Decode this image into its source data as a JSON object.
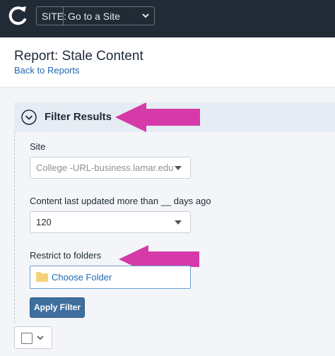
{
  "topbar": {
    "site_label": "SITE:",
    "site_value": "Go to a Site"
  },
  "header": {
    "title": "Report: Stale Content",
    "back_link": "Back to Reports"
  },
  "filter": {
    "title": "Filter Results",
    "site": {
      "label": "Site",
      "value": "College -URL-business.lamar.edu"
    },
    "days": {
      "label": "Content last updated more than __ days ago",
      "value": "120"
    },
    "folders": {
      "label": "Restrict to folders",
      "button": "Choose Folder"
    },
    "apply_label": "Apply Filter"
  },
  "colors": {
    "topbar": "#212b36",
    "link": "#1f69b3",
    "arrow": "#d63aa8",
    "primary_button": "#3e6f9e"
  }
}
